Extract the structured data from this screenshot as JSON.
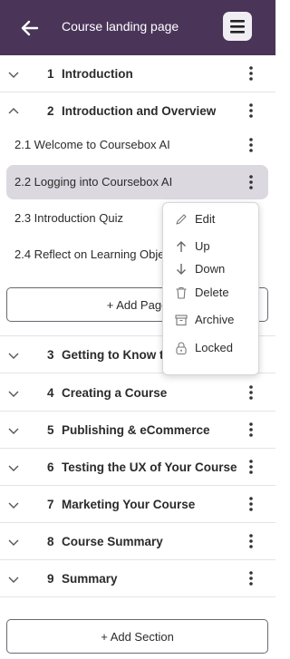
{
  "header": {
    "title": "Course landing page"
  },
  "sections": [
    {
      "num": "1",
      "title": "Introduction"
    },
    {
      "num": "2",
      "title": "Introduction and Overview"
    },
    {
      "num": "3",
      "title": "Getting to Know the Coursebox"
    },
    {
      "num": "4",
      "title": "Creating a Course"
    },
    {
      "num": "5",
      "title": "Publishing & eCommerce"
    },
    {
      "num": "6",
      "title": "Testing the UX of Your Course"
    },
    {
      "num": "7",
      "title": "Marketing Your Course"
    },
    {
      "num": "8",
      "title": "Course Summary"
    },
    {
      "num": "9",
      "title": "Summary"
    }
  ],
  "lessons": [
    {
      "title": "2.1 Welcome to Coursebox AI"
    },
    {
      "title": "2.2 Logging into Coursebox AI"
    },
    {
      "title": "2.3 Introduction Quiz"
    },
    {
      "title": "2.4 Reflect on Learning Objectives"
    }
  ],
  "add_page_label": "+ Add Page",
  "add_section_label": "+ Add Section",
  "context_menu": {
    "items": [
      {
        "label": "Edit",
        "icon": "pencil-icon"
      },
      {
        "label": "Up",
        "icon": "arrow-up-icon"
      },
      {
        "label": "Down",
        "icon": "arrow-down-icon"
      },
      {
        "label": "Delete",
        "icon": "trash-icon"
      },
      {
        "label": "Archive",
        "icon": "archive-icon"
      },
      {
        "label": "Locked",
        "icon": "lock-icon"
      }
    ]
  },
  "colors": {
    "header_bg": "#4a3559",
    "active_lesson_bg": "#dcd8e0"
  }
}
